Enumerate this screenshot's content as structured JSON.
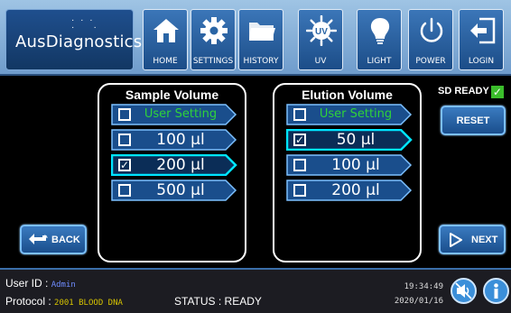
{
  "header": {
    "logo": "AusDiagnostics",
    "nav": [
      {
        "label": "HOME",
        "icon": "home-icon"
      },
      {
        "label": "SETTINGS",
        "icon": "gear-icon"
      },
      {
        "label": "HISTORY",
        "icon": "folder-icon"
      },
      {
        "label": "UV",
        "icon": "uv-icon",
        "icon_text": "UV"
      },
      {
        "label": "LIGHT",
        "icon": "lightbulb-icon"
      },
      {
        "label": "POWER",
        "icon": "power-icon"
      },
      {
        "label": "LOGIN",
        "icon": "login-icon"
      }
    ]
  },
  "sample_volume": {
    "title": "Sample Volume",
    "options": [
      {
        "label": "User Setting",
        "checked": false,
        "selected": false
      },
      {
        "label": "100 µl",
        "checked": false,
        "selected": false
      },
      {
        "label": "200 µl",
        "checked": true,
        "selected": true
      },
      {
        "label": "500 µl",
        "checked": false,
        "selected": false
      }
    ]
  },
  "elution_volume": {
    "title": "Elution Volume",
    "options": [
      {
        "label": "User Setting",
        "checked": false,
        "selected": false
      },
      {
        "label": "50 µl",
        "checked": true,
        "selected": true
      },
      {
        "label": "100 µl",
        "checked": false,
        "selected": false
      },
      {
        "label": "200 µl",
        "checked": false,
        "selected": false
      }
    ]
  },
  "status_panel": {
    "sd_label": "SD READY",
    "sd_check": "✓",
    "reset_label": "RESET",
    "back_label": "BACK",
    "next_label": "NEXT"
  },
  "footer": {
    "user_id_label": "User ID :",
    "user_id_value": "Admin",
    "protocol_label": "Protocol :",
    "protocol_value": "2001 BLOOD DNA",
    "status_text": "STATUS : READY",
    "time": "19:34:49",
    "date": "2020/01/16"
  },
  "colors": {
    "header_bg": "#8fb7de",
    "button_blue": "#1f5a9a",
    "accent_cyan": "#00e5ff",
    "user_setting_green": "#2fd33a",
    "protocol_yellow": "#d6c300"
  }
}
